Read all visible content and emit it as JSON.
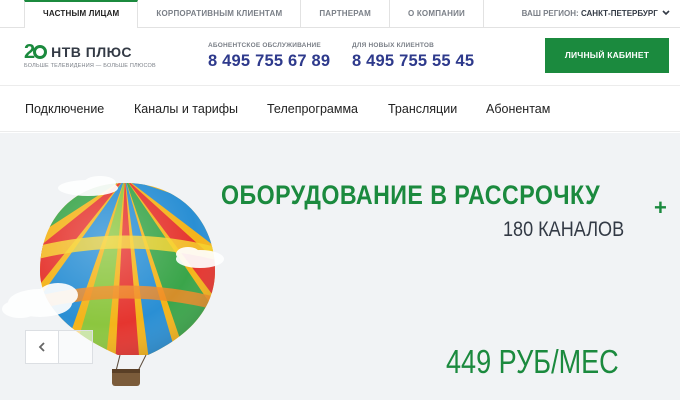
{
  "topbar": {
    "tabs": [
      {
        "label": "ЧАСТНЫМ ЛИЦАМ",
        "active": true
      },
      {
        "label": "КОРПОРАТИВНЫМ КЛИЕНТАМ",
        "active": false
      },
      {
        "label": "ПАРТНЕРАМ",
        "active": false
      },
      {
        "label": "О КОМПАНИИ",
        "active": false
      }
    ],
    "region_label": "ВАШ РЕГИОН:",
    "region_city": "САНКТ-ПЕТЕРБУРГ",
    "region_icon": "chevron-down-icon"
  },
  "header": {
    "logo": {
      "number": "2",
      "brand": "НТВ ПЛЮС",
      "slogan": "БОЛЬШЕ ТЕЛЕВИДЕНИЯ — БОЛЬШЕ ПЛЮСОВ"
    },
    "contacts": [
      {
        "label": "АБОНЕНТСКОЕ ОБСЛУЖИВАНИЕ",
        "phone": "8 495 755 67 89"
      },
      {
        "label": "ДЛЯ НОВЫХ КЛИЕНТОВ",
        "phone": "8 495 755 55 45"
      }
    ],
    "cabinet_label": "ЛИЧНЫЙ КАБИНЕТ"
  },
  "nav": {
    "items": [
      "Подключение",
      "Каналы и тарифы",
      "Телепрограмма",
      "Трансляции",
      "Абонентам"
    ]
  },
  "hero": {
    "title": "ОБОРУДОВАНИЕ В РАССРОЧКУ",
    "plus": "+",
    "subtitle": "180 КАНАЛОВ",
    "price": "449 РУБ/МЕС",
    "prev_icon": "chevron-left-icon"
  },
  "colors": {
    "brand_green": "#1b8a3e",
    "phone_blue": "#2e3a8c",
    "hero_bg": "#f1f3f5"
  }
}
